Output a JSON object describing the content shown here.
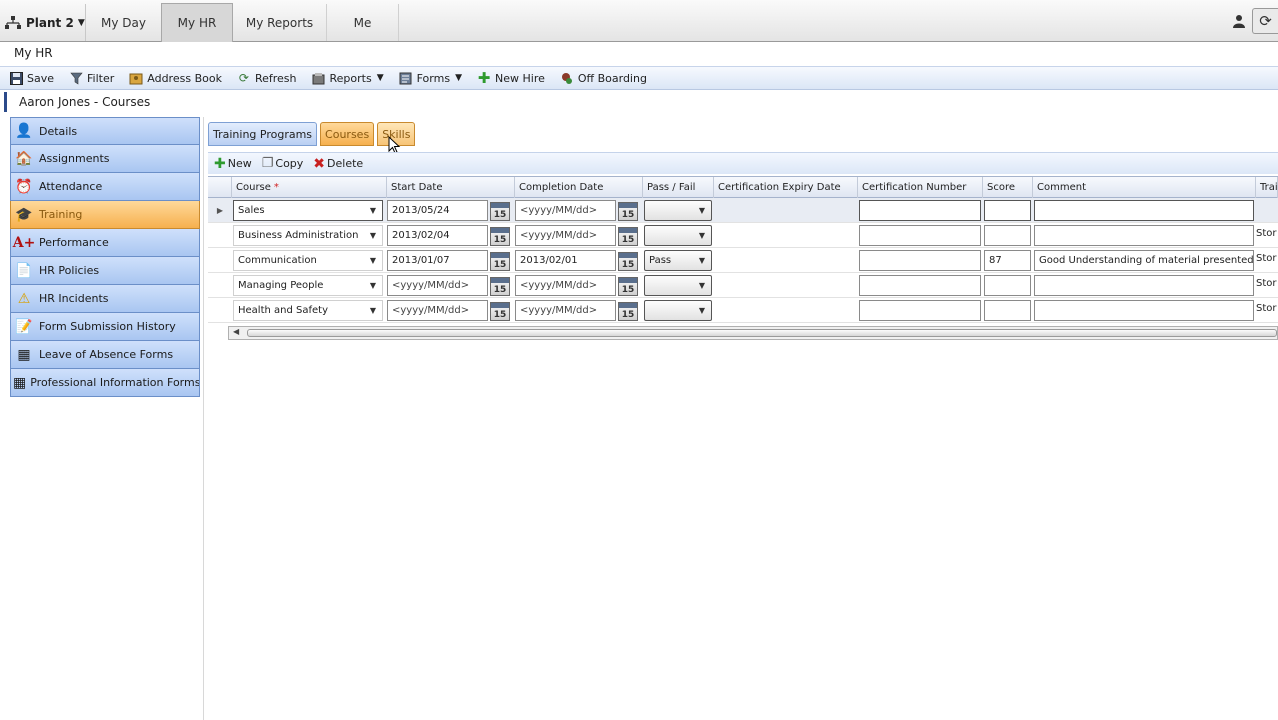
{
  "topnav": {
    "brand": "Plant 2",
    "tabs": [
      "My Day",
      "My HR",
      "My Reports",
      "Me"
    ],
    "active_tab": "My HR"
  },
  "page_title": "My HR",
  "toolbar": {
    "save": "Save",
    "filter": "Filter",
    "address_book": "Address Book",
    "refresh": "Refresh",
    "reports": "Reports",
    "forms": "Forms",
    "new_hire": "New Hire",
    "off_boarding": "Off Boarding"
  },
  "breadcrumb": "Aaron Jones - Courses",
  "sidebar": {
    "items": [
      {
        "label": "Details",
        "icon": "person-icon"
      },
      {
        "label": "Assignments",
        "icon": "house-person-icon"
      },
      {
        "label": "Attendance",
        "icon": "clock-person-icon"
      },
      {
        "label": "Training",
        "icon": "graduate-icon"
      },
      {
        "label": "Performance",
        "icon": "a-plus-icon"
      },
      {
        "label": "HR Policies",
        "icon": "document-icon"
      },
      {
        "label": "HR Incidents",
        "icon": "warning-icon"
      },
      {
        "label": "Form Submission History",
        "icon": "form-icon"
      },
      {
        "label": "Leave of Absence Forms",
        "icon": "form-grid-icon"
      },
      {
        "label": "Professional Information Forms",
        "icon": "form-grid-icon"
      }
    ],
    "active": "Training"
  },
  "inner_tabs": [
    "Training Programs",
    "Courses",
    "Skills"
  ],
  "grid_toolbar": {
    "new": "New",
    "copy": "Copy",
    "delete": "Delete"
  },
  "grid": {
    "columns": [
      "Course",
      "Start Date",
      "Completion Date",
      "Pass / Fail",
      "Certification Expiry Date",
      "Certification Number",
      "Score",
      "Comment",
      "Trai"
    ],
    "required_marker": "*",
    "date_placeholder": "<yyyy/MM/dd>",
    "calendar_label": "15",
    "rows": [
      {
        "course": "Sales",
        "start": "2013/05/24",
        "completion": "",
        "pass_fail": "",
        "score": "",
        "comment": "",
        "trail": ""
      },
      {
        "course": "Business Administration",
        "start": "2013/02/04",
        "completion": "",
        "pass_fail": "",
        "score": "",
        "comment": "",
        "trail": "Stor"
      },
      {
        "course": "Communication",
        "start": "2013/01/07",
        "completion": "2013/02/01",
        "pass_fail": "Pass",
        "score": "87",
        "comment": "Good Understanding of material presented",
        "trail": "Stor"
      },
      {
        "course": "Managing People",
        "start": "",
        "completion": "",
        "pass_fail": "",
        "score": "",
        "comment": "",
        "trail": "Stor"
      },
      {
        "course": "Health and Safety",
        "start": "",
        "completion": "",
        "pass_fail": "",
        "score": "",
        "comment": "",
        "trail": "Stor"
      }
    ]
  }
}
